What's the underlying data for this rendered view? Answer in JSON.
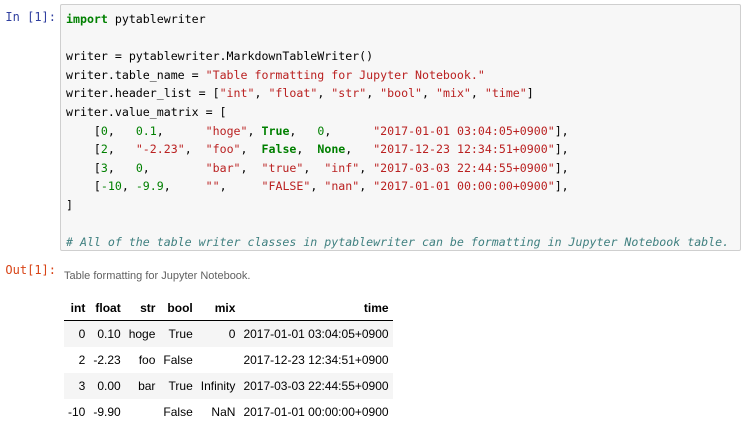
{
  "cell": {
    "in_prompt": "In [1]:",
    "out_prompt": "Out[1]:",
    "code_lines": [
      "import pytablewriter",
      "",
      "writer = pytablewriter.MarkdownTableWriter()",
      "writer.table_name = \"Table formatting for Jupyter Notebook.\"",
      "writer.header_list = [\"int\", \"float\", \"str\", \"bool\", \"mix\", \"time\"]",
      "writer.value_matrix = [",
      "    [0,   0.1,      \"hoge\", True,   0,      \"2017-01-01 03:04:05+0900\"],",
      "    [2,   \"-2.23\",  \"foo\",  False,  None,   \"2017-12-23 12:34:51+0900\"],",
      "    [3,   0,        \"bar\",  \"true\",  \"inf\", \"2017-03-03 22:44:55+0900\"],",
      "    [-10, -9.9,     \"\",     \"FALSE\", \"nan\", \"2017-01-01 00:00:00+0900\"],",
      "]",
      "",
      "# All of the table writer classes in pytablewriter can be formatting in Jupyter Notebook table.",
      "writer"
    ]
  },
  "output": {
    "caption": "Table formatting for Jupyter Notebook.",
    "headers": [
      "int",
      "float",
      "str",
      "bool",
      "mix",
      "time"
    ],
    "rows": [
      [
        "0",
        "0.10",
        "hoge",
        "True",
        "0",
        "2017-01-01 03:04:05+0900"
      ],
      [
        "2",
        "-2.23",
        "foo",
        "False",
        "",
        "2017-12-23 12:34:51+0900"
      ],
      [
        "3",
        "0.00",
        "bar",
        "True",
        "Infinity",
        "2017-03-03 22:44:55+0900"
      ],
      [
        "-10",
        "-9.90",
        "",
        "False",
        "NaN",
        "2017-01-01 00:00:00+0900"
      ]
    ]
  }
}
